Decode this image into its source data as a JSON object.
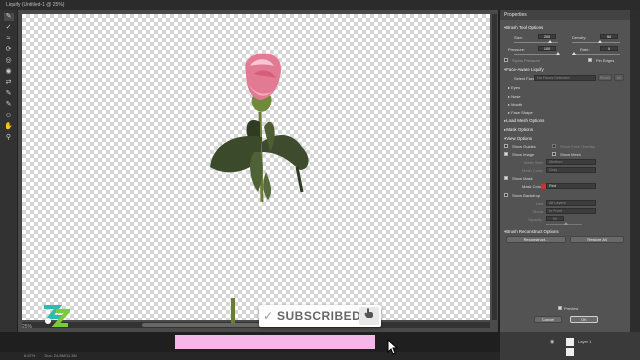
{
  "window": {
    "title": "Liquify (Untitled-1 @ 25%)"
  },
  "tools": [
    "forward-warp-icon",
    "reconstruct-icon",
    "smooth-icon",
    "twirl-icon",
    "pucker-icon",
    "bloat-icon",
    "push-left-icon",
    "freeze-mask-icon",
    "thaw-mask-icon",
    "face-tool-icon",
    "hand-icon",
    "zoom-icon"
  ],
  "canvas": {
    "zoom": "25%"
  },
  "properties": {
    "title": "Properties",
    "brush_tool_options": {
      "label": "Brush Tool Options",
      "size_label": "Size:",
      "size_value": "200",
      "density_label": "Density:",
      "density_value": "50",
      "pressure_label": "Pressure:",
      "pressure_value": "100",
      "rate_label": "Rate:",
      "rate_value": "0",
      "stylus_label": "Stylus Pressure",
      "pin_edges_label": "Pin Edges"
    },
    "face_aware": {
      "label": "Face-Aware Liquify",
      "select_face_label": "Select Face:",
      "select_face_value": "No Faces Detected",
      "reset_label": "Reset",
      "all_label": "All",
      "items": [
        "Eyes",
        "Nose",
        "Mouth",
        "Face Shape"
      ]
    },
    "load_mesh_label": "Load Mesh Options",
    "mask_options_label": "Mask Options",
    "view_options": {
      "label": "View Options",
      "show_guides": "Show Guides",
      "show_face_overlay": "Show Face Overlay",
      "show_image": "Show Image",
      "show_mesh": "Show Mesh",
      "mesh_size_label": "Mesh Size:",
      "mesh_size_value": "Medium",
      "mesh_color_label": "Mesh Color:",
      "mesh_color_value": "Gray",
      "show_mask": "Show Mask",
      "mask_color_label": "Mask Color:",
      "mask_color_value": "Red",
      "mask_color_hex": "#d03030",
      "show_backdrop": "Show Backdrop",
      "use_label": "Use:",
      "use_value": "All Layers",
      "mode_label": "Mode:",
      "mode_value": "In Front",
      "opacity_label": "Opacity:",
      "opacity_value": "50"
    },
    "brush_reconstruct": {
      "label": "Brush Reconstruct Options",
      "reconstruct_label": "Reconstruct...",
      "restore_all_label": "Restore All"
    },
    "preview_label": "Preview",
    "cancel_label": "Cancel",
    "ok_label": "OK"
  },
  "layers": {
    "layer_name": "Layer 1"
  },
  "status": {
    "zoom": "6.67%",
    "doc": "Doc: 24.8M/11.3M"
  },
  "overlay": {
    "subscribed_label": "SUBSCRIBED",
    "check_glyph": "✓",
    "pink_bar_color": "#f6b6e8"
  }
}
